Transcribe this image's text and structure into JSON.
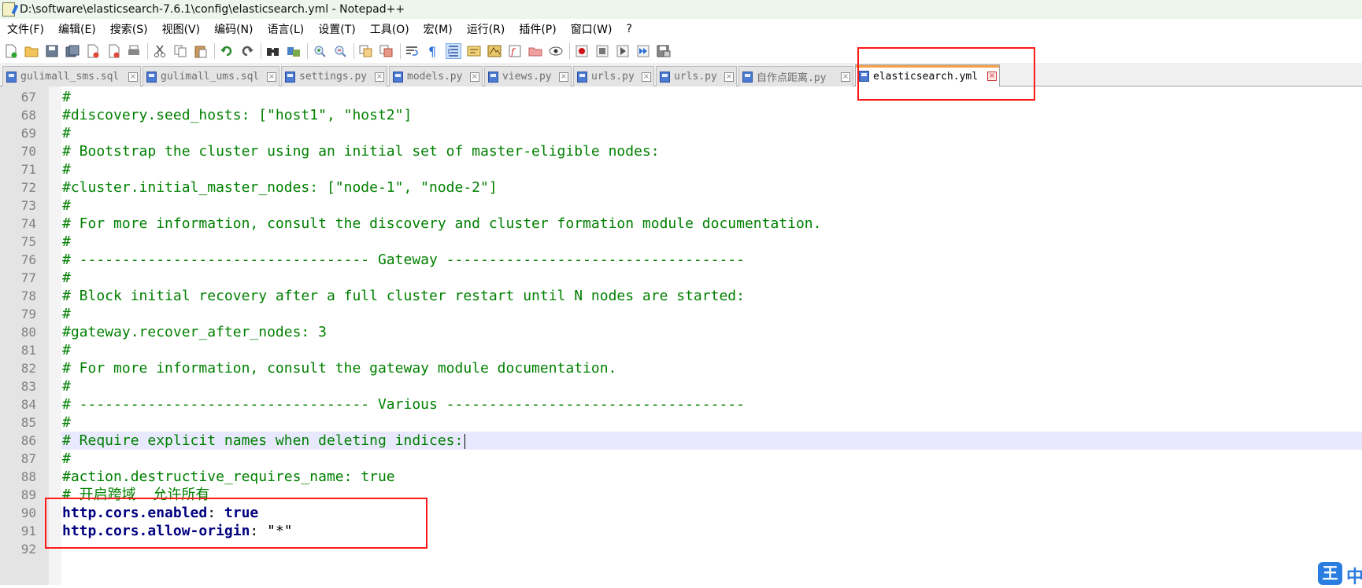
{
  "window": {
    "title": "D:\\software\\elasticsearch-7.6.1\\config\\elasticsearch.yml - Notepad++"
  },
  "menu": [
    "文件(F)",
    "编辑(E)",
    "搜索(S)",
    "视图(V)",
    "编码(N)",
    "语言(L)",
    "设置(T)",
    "工具(O)",
    "宏(M)",
    "运行(R)",
    "插件(P)",
    "窗口(W)",
    "?"
  ],
  "tabs": [
    {
      "label": "gulimall_sms.sql",
      "active": false
    },
    {
      "label": "gulimall_ums.sql",
      "active": false
    },
    {
      "label": "settings.py",
      "active": false
    },
    {
      "label": "models.py",
      "active": false
    },
    {
      "label": "views.py",
      "active": false
    },
    {
      "label": "urls.py",
      "active": false
    },
    {
      "label": "urls.py",
      "active": false
    },
    {
      "label": "自作点距离.py",
      "active": false
    },
    {
      "label": "elasticsearch.yml",
      "active": true
    }
  ],
  "editor": {
    "current_line": 86,
    "lines": [
      {
        "n": "67",
        "text": "#"
      },
      {
        "n": "68",
        "text": "#discovery.seed_hosts: [\"host1\", \"host2\"]"
      },
      {
        "n": "69",
        "text": "#"
      },
      {
        "n": "70",
        "text": "# Bootstrap the cluster using an initial set of master-eligible nodes:"
      },
      {
        "n": "71",
        "text": "#"
      },
      {
        "n": "72",
        "text": "#cluster.initial_master_nodes: [\"node-1\", \"node-2\"]"
      },
      {
        "n": "73",
        "text": "#"
      },
      {
        "n": "74",
        "text": "# For more information, consult the discovery and cluster formation module documentation."
      },
      {
        "n": "75",
        "text": "#"
      },
      {
        "n": "76",
        "text": "# ---------------------------------- Gateway -----------------------------------"
      },
      {
        "n": "77",
        "text": "#"
      },
      {
        "n": "78",
        "text": "# Block initial recovery after a full cluster restart until N nodes are started:"
      },
      {
        "n": "79",
        "text": "#"
      },
      {
        "n": "80",
        "text": "#gateway.recover_after_nodes: 3"
      },
      {
        "n": "81",
        "text": "#"
      },
      {
        "n": "82",
        "text": "# For more information, consult the gateway module documentation."
      },
      {
        "n": "83",
        "text": "#"
      },
      {
        "n": "84",
        "text": "# ---------------------------------- Various -----------------------------------"
      },
      {
        "n": "85",
        "text": "#"
      },
      {
        "n": "86",
        "text": "# Require explicit names when deleting indices:"
      },
      {
        "n": "87",
        "text": "#"
      },
      {
        "n": "88",
        "text": "#action.destructive_requires_name: true"
      },
      {
        "n": "89",
        "text": "# 开启跨域  允许所有"
      },
      {
        "n": "90",
        "key": "http.cors.enabled",
        "sep": ": ",
        "value": "true",
        "value_kw": true
      },
      {
        "n": "91",
        "key": "http.cors.allow-origin",
        "sep": ": ",
        "value": "\"*\"",
        "value_kw": false
      },
      {
        "n": "92",
        "text": ""
      }
    ]
  },
  "ime": {
    "icon_text": "王",
    "mode_char": "中"
  },
  "colors": {
    "comment": "#008000",
    "keyword": "#000080",
    "annotation": "#ff1a1a",
    "active_tab_accent": "#f6a34a",
    "current_line": "#e8e8ff"
  }
}
